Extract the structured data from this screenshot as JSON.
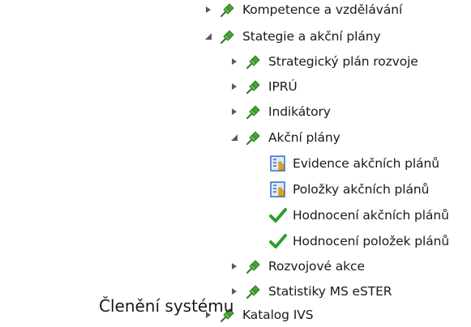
{
  "tree": {
    "items": [
      {
        "label": "Kompetence a vzdělávání",
        "icon": "pushpin-icon",
        "arrow": "collapsed"
      },
      {
        "label": "Stategie a akční plány",
        "icon": "pushpin-icon",
        "arrow": "expanded"
      },
      {
        "label": "Strategický plán rozvoje",
        "icon": "pushpin-icon",
        "arrow": "collapsed"
      },
      {
        "label": "IPRÚ",
        "icon": "pushpin-icon",
        "arrow": "collapsed"
      },
      {
        "label": "Indikátory",
        "icon": "pushpin-icon",
        "arrow": "collapsed"
      },
      {
        "label": "Akční plány",
        "icon": "pushpin-icon",
        "arrow": "expanded"
      },
      {
        "label": "Evidence akčních plánů",
        "icon": "form-report-icon",
        "arrow": "none"
      },
      {
        "label": "Položky akčních plánů",
        "icon": "form-report-icon",
        "arrow": "none"
      },
      {
        "label": "Hodnocení akčních plánů",
        "icon": "checkmark-icon",
        "arrow": "none"
      },
      {
        "label": "Hodnocení položek plánů",
        "icon": "checkmark-icon",
        "arrow": "none"
      },
      {
        "label": "Rozvojové akce",
        "icon": "pushpin-icon",
        "arrow": "collapsed"
      },
      {
        "label": "Statistiky MS eSTER",
        "icon": "pushpin-icon",
        "arrow": "collapsed"
      },
      {
        "label": "Katalog IVS",
        "icon": "pushpin-icon",
        "arrow": "collapsed"
      }
    ]
  },
  "caption": "Členění systému",
  "colors": {
    "pin": "#4aa33a",
    "pin_dark": "#2f7a24",
    "check": "#2e9e2e",
    "report_blue": "#3a6fc4",
    "report_yellow": "#f2b21c",
    "arrow": "#6b6b6b"
  }
}
